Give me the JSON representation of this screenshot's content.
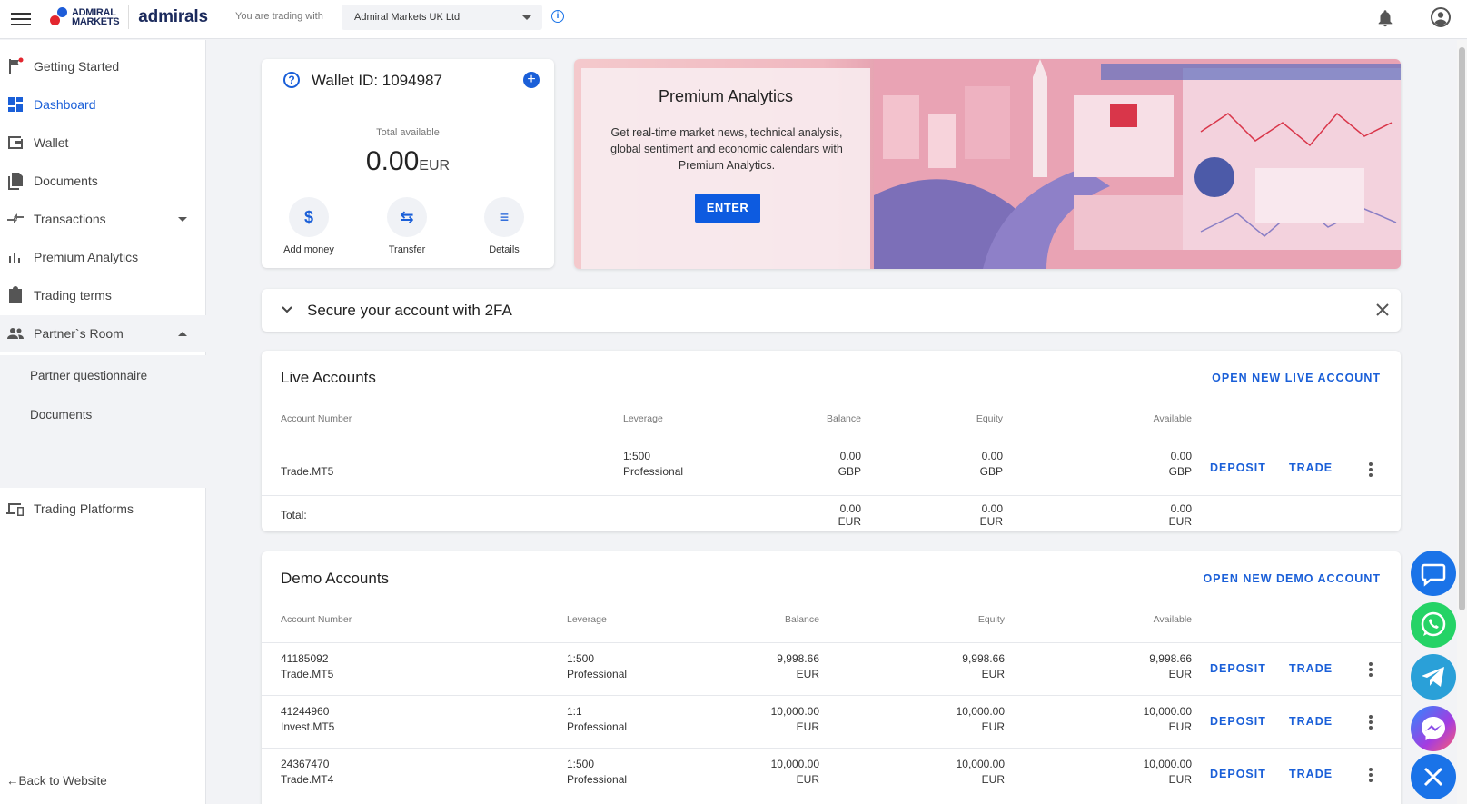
{
  "header": {
    "brand_line1": "ADMIRAL",
    "brand_line2": "MARKETS",
    "brand_name": "admirals",
    "trading_with_label": "You are trading with",
    "entity_selected": "Admiral Markets UK Ltd"
  },
  "sidebar": {
    "items": [
      {
        "label": "Getting Started",
        "icon": "flag-icon"
      },
      {
        "label": "Dashboard",
        "icon": "dashboard-icon"
      },
      {
        "label": "Wallet",
        "icon": "wallet-icon"
      },
      {
        "label": "Documents",
        "icon": "documents-icon"
      },
      {
        "label": "Transactions",
        "icon": "transactions-icon"
      },
      {
        "label": "Premium Analytics",
        "icon": "bar-chart-icon"
      },
      {
        "label": "Trading terms",
        "icon": "clipboard-icon"
      },
      {
        "label": "Partner`s Room",
        "icon": "people-icon"
      },
      {
        "label": "Trading Platforms",
        "icon": "devices-icon"
      }
    ],
    "sub_items": [
      "Partner questionnaire",
      "Documents"
    ],
    "back_link": "Back to Website",
    "active_color": "#1a5fd8"
  },
  "wallet": {
    "title": "Wallet ID: 1094987",
    "total_label": "Total available",
    "total_value": "0.00",
    "total_currency": "EUR",
    "actions": [
      {
        "label": "Add money",
        "icon": "dollar-icon"
      },
      {
        "label": "Transfer",
        "icon": "transfer-icon"
      },
      {
        "label": "Details",
        "icon": "list-icon"
      }
    ]
  },
  "banner": {
    "title": "Premium Analytics",
    "description": "Get real-time market news, technical analysis, global sentiment and economic calendars with Premium Analytics.",
    "button": "ENTER"
  },
  "twofa": {
    "title": "Secure your account with 2FA"
  },
  "live_accounts": {
    "title": "Live Accounts",
    "open_new": "OPEN NEW LIVE ACCOUNT",
    "columns": [
      "Account Number",
      "Leverage",
      "Balance",
      "Equity",
      "Available"
    ],
    "rows": [
      {
        "number": "",
        "type": "Trade.MT5",
        "leverage": "1:500",
        "class": "Professional",
        "balance": "0.00",
        "balance_cur": "GBP",
        "equity": "0.00",
        "equity_cur": "GBP",
        "available": "0.00",
        "available_cur": "GBP"
      }
    ],
    "total": {
      "label": "Total:",
      "balance": "0.00",
      "balance_cur": "EUR",
      "equity": "0.00",
      "equity_cur": "EUR",
      "available": "0.00",
      "available_cur": "EUR"
    },
    "deposit_label": "DEPOSIT",
    "trade_label": "TRADE"
  },
  "demo_accounts": {
    "title": "Demo Accounts",
    "open_new": "OPEN NEW DEMO ACCOUNT",
    "columns": [
      "Account Number",
      "Leverage",
      "Balance",
      "Equity",
      "Available"
    ],
    "rows": [
      {
        "number": "41185092",
        "type": "Trade.MT5",
        "leverage": "1:500",
        "class": "Professional",
        "balance": "9,998.66",
        "balance_cur": "EUR",
        "equity": "9,998.66",
        "equity_cur": "EUR",
        "available": "9,998.66",
        "available_cur": "EUR"
      },
      {
        "number": "41244960",
        "type": "Invest.MT5",
        "leverage": "1:1",
        "class": "Professional",
        "balance": "10,000.00",
        "balance_cur": "EUR",
        "equity": "10,000.00",
        "equity_cur": "EUR",
        "available": "10,000.00",
        "available_cur": "EUR"
      },
      {
        "number": "24367470",
        "type": "Trade.MT4",
        "leverage": "1:500",
        "class": "Professional",
        "balance": "10,000.00",
        "balance_cur": "EUR",
        "equity": "10,000.00",
        "equity_cur": "EUR",
        "available": "10,000.00",
        "available_cur": "EUR"
      }
    ],
    "deposit_label": "DEPOSIT",
    "trade_label": "TRADE"
  },
  "chat_buttons": [
    {
      "icon": "chat-icon",
      "color": "#1a73e8"
    },
    {
      "icon": "whatsapp-icon",
      "color": "#25d366"
    },
    {
      "icon": "telegram-icon",
      "color": "#2aa0d8"
    },
    {
      "icon": "messenger-icon",
      "color": "#7b4bf0"
    },
    {
      "icon": "close-icon",
      "color": "#1a73e8"
    }
  ]
}
